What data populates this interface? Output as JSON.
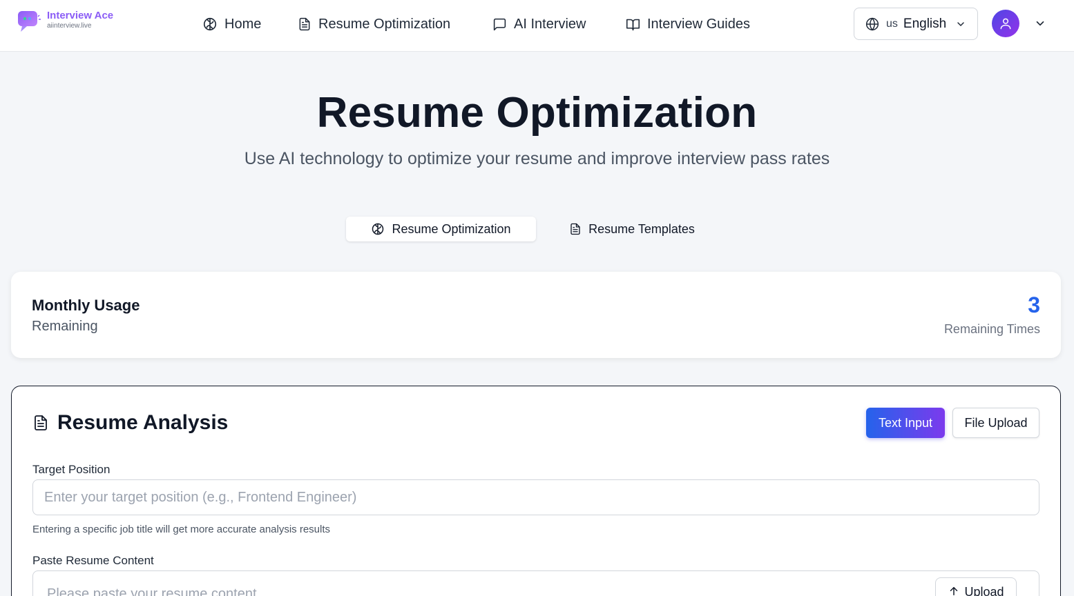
{
  "header": {
    "logo_title": "Interview Ace",
    "logo_subtitle": "aiinterview.live",
    "nav": [
      {
        "label": "Home",
        "icon": "brain-icon"
      },
      {
        "label": "Resume Optimization",
        "icon": "file-text-icon"
      },
      {
        "label": "AI Interview",
        "icon": "chat-bubble-icon"
      },
      {
        "label": "Interview Guides",
        "icon": "book-open-icon"
      }
    ],
    "language": {
      "flag": "us",
      "label": "English"
    }
  },
  "hero": {
    "title": "Resume Optimization",
    "subtitle": "Use AI technology to optimize your resume and improve interview pass rates"
  },
  "tabs": [
    {
      "label": "Resume Optimization",
      "active": true
    },
    {
      "label": "Resume Templates",
      "active": false
    }
  ],
  "usage": {
    "title": "Monthly Usage",
    "subtitle": "Remaining",
    "count": "3",
    "count_label": "Remaining Times"
  },
  "analysis": {
    "title": "Resume Analysis",
    "text_input_label": "Text Input",
    "file_upload_label": "File Upload",
    "target_position_label": "Target Position",
    "target_position_placeholder": "Enter your target position (e.g., Frontend Engineer)",
    "target_position_value": "",
    "target_position_hint": "Entering a specific job title will get more accurate analysis results",
    "resume_content_label": "Paste Resume Content",
    "resume_content_placeholder": "Please paste your resume content",
    "upload_label": "Upload"
  },
  "colors": {
    "brand": "#8b5cf6",
    "accent_blue": "#2563eb",
    "accent_purple": "#7c3aed",
    "text_primary": "#111827",
    "text_secondary": "#4b5563"
  }
}
